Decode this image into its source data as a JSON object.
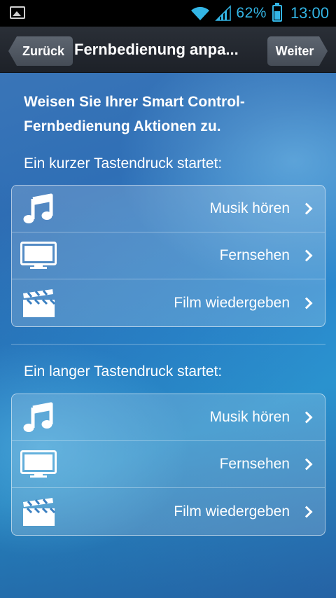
{
  "status_bar": {
    "battery_percent": "62%",
    "time": "13:00",
    "accent_color": "#33b5e5"
  },
  "action_bar": {
    "back_label": "Zurück",
    "title": "Fernbedienung anpa...",
    "next_label": "Weiter"
  },
  "intro": "Weisen Sie Ihrer Smart Control-Fernbedienung Aktionen zu.",
  "short_press": {
    "label": "Ein kurzer Tastendruck startet:",
    "items": [
      {
        "icon": "music-note-icon",
        "label": "Musik hören"
      },
      {
        "icon": "tv-icon",
        "label": "Fernsehen"
      },
      {
        "icon": "clapperboard-icon",
        "label": "Film wiedergeben"
      }
    ]
  },
  "long_press": {
    "label": "Ein langer Tastendruck startet:",
    "items": [
      {
        "icon": "music-note-icon",
        "label": "Musik hören"
      },
      {
        "icon": "tv-icon",
        "label": "Fernsehen"
      },
      {
        "icon": "clapperboard-icon",
        "label": "Film wiedergeben"
      }
    ]
  }
}
